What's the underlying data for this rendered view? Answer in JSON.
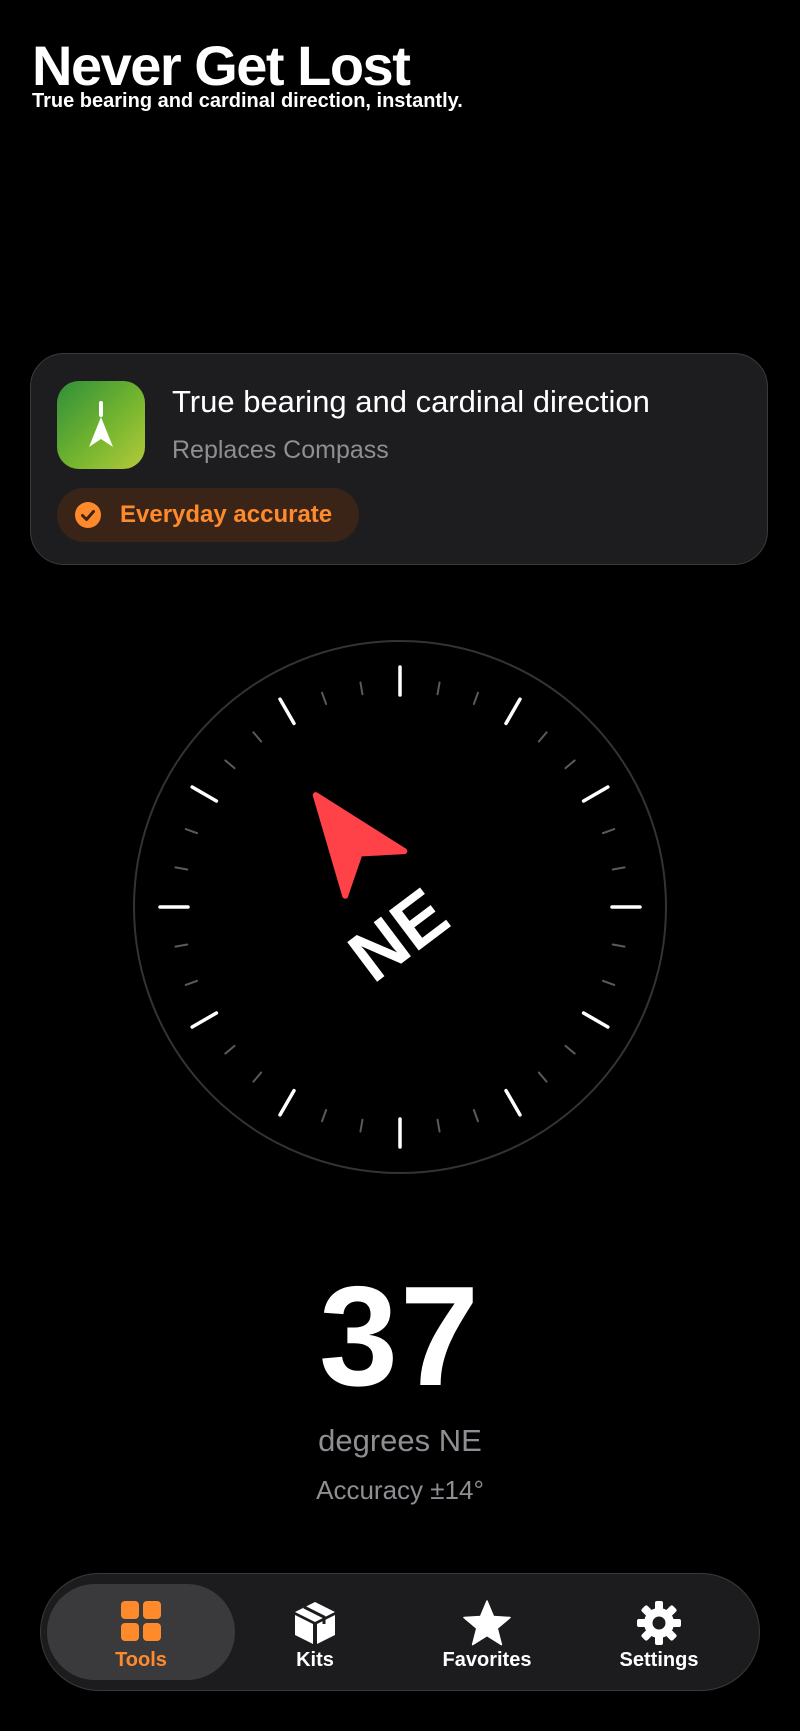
{
  "header": {
    "title": "Never Get Lost",
    "subtitle": "True bearing and cardinal direction, instantly."
  },
  "card": {
    "icon": "compass-arrow-icon",
    "title": "True bearing and cardinal direction",
    "subtitle": "Replaces Compass",
    "badge": "Everyday accurate",
    "badge_icon": "check-circle-icon"
  },
  "compass": {
    "heading_degrees": 37,
    "direction_label": "NE",
    "needle_color": "#ff4148"
  },
  "readout": {
    "heading": "37",
    "label": "degrees NE",
    "accuracy": "Accuracy ±14°"
  },
  "tabbar": {
    "tabs": [
      {
        "label": "Tools",
        "icon": "grid-icon",
        "active": true
      },
      {
        "label": "Kits",
        "icon": "box-icon",
        "active": false
      },
      {
        "label": "Favorites",
        "icon": "star-icon",
        "active": false
      },
      {
        "label": "Settings",
        "icon": "gear-icon",
        "active": false
      }
    ]
  },
  "colors": {
    "accent": "#ff8a2b",
    "background": "#000000",
    "card": "#1d1d1f",
    "secondary_text": "#8e8e93"
  }
}
